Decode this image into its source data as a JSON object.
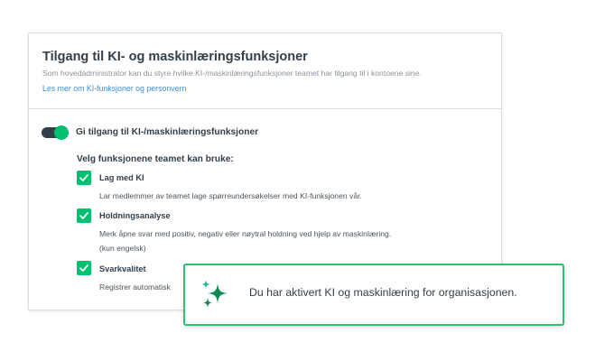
{
  "card": {
    "title": "Tilgang til KI- og maskinlæringsfunksjoner",
    "description": "Som hovedadministrator kan du styre hvilke KI-/maskinlæringsfunksjoner teamet har tilgang til i kontoene sine.",
    "link": "Les mer om KI-funksjoner og personvern"
  },
  "toggle": {
    "label": "Gi tilgang til KI-/maskinlæringsfunksjoner",
    "state": "on"
  },
  "features": {
    "heading": "Velg funksjonene teamet kan bruke:",
    "items": [
      {
        "label": "Lag med KI",
        "desc": "Lar medlemmer av teamet lage spørreundersøkelser med KI-funksjonen vår.",
        "checked": true
      },
      {
        "label": "Holdningsanalyse",
        "desc": "Merk åpne svar med positiv, negativ eller nøytral holdning ved hjelp av maskinlæring.",
        "desc2": "(kun engelsk)",
        "checked": true
      },
      {
        "label": "Svarkvalitet",
        "desc": "Registrer automatisk",
        "checked": true
      }
    ]
  },
  "toast": {
    "message": "Du har aktivert KI og maskinlæring for organisasjonen.",
    "icon": "sparkle-icon"
  },
  "colors": {
    "accent": "#00bf6f",
    "link": "#3d8fd1",
    "text": "#333e48",
    "muted": "#8a939b"
  }
}
